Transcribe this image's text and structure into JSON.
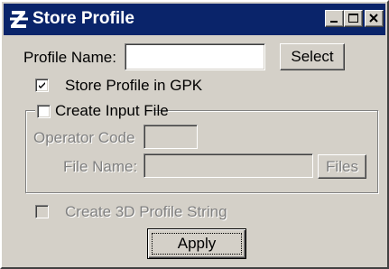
{
  "window": {
    "title": "Store Profile",
    "controls": {
      "minimize": "minimize",
      "maximize": "maximize",
      "close": "close"
    }
  },
  "form": {
    "profile_name_label": "Profile Name:",
    "profile_name_value": "",
    "select_button": "Select",
    "store_in_gpk": {
      "label": "Store Profile in GPK",
      "checked": true
    },
    "create_input_file": {
      "label": "Create Input File",
      "checked": false
    },
    "operator_code_label": "Operator Code",
    "operator_code_value": "",
    "file_name_label": "File Name:",
    "file_name_value": "",
    "files_button": "Files",
    "create_3d_profile": {
      "label": "Create 3D Profile String",
      "checked": false,
      "enabled": false
    },
    "apply_button": "Apply"
  },
  "colors": {
    "titlebar": "#0a246a",
    "dialog_face": "#d4d0c8",
    "disabled_text": "#808080"
  }
}
